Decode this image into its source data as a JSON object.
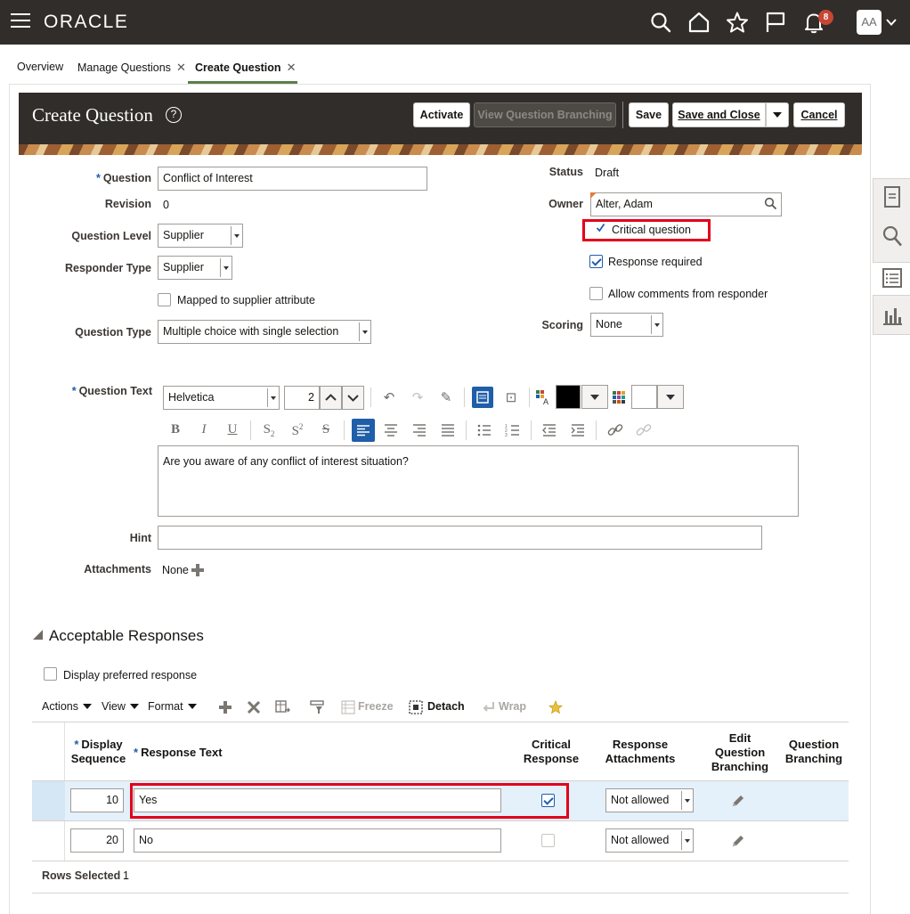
{
  "app": {
    "brand": "ORACLE",
    "notification_count": "8",
    "avatar_initials": "AA"
  },
  "tabs": [
    {
      "label": "Overview"
    },
    {
      "label": "Manage Questions"
    },
    {
      "label": "Create Question"
    }
  ],
  "header": {
    "title": "Create Question",
    "activate": "Activate",
    "view_branching": "View Question Branching",
    "save": "Save",
    "save_close": "Save and Close",
    "cancel": "Cancel"
  },
  "form": {
    "question_label": "Question",
    "question_value": "Conflict of Interest",
    "revision_label": "Revision",
    "revision_value": "0",
    "question_level_label": "Question Level",
    "question_level_value": "Supplier",
    "responder_type_label": "Responder Type",
    "responder_type_value": "Supplier",
    "mapped_label": "Mapped to supplier attribute",
    "question_type_label": "Question Type",
    "question_type_value": "Multiple choice with single selection",
    "status_label": "Status",
    "status_value": "Draft",
    "owner_label": "Owner",
    "owner_value": "Alter, Adam",
    "critical_label": "Critical question",
    "response_required_label": "Response required",
    "allow_comments_label": "Allow comments from responder",
    "scoring_label": "Scoring",
    "scoring_value": "None",
    "question_text_label": "Question Text",
    "font_value": "Helvetica",
    "font_size_value": "2",
    "question_text_value": "Are you aware of any conflict of interest situation?",
    "hint_label": "Hint",
    "hint_value": "",
    "attachments_label": "Attachments",
    "attachments_value": "None"
  },
  "responses": {
    "section_title": "Acceptable Responses",
    "display_preferred_label": "Display preferred response",
    "toolbar": {
      "actions": "Actions",
      "view": "View",
      "format": "Format",
      "freeze": "Freeze",
      "detach": "Detach",
      "wrap": "Wrap"
    },
    "columns": {
      "display_sequence_1": "Display",
      "display_sequence_2": "Sequence",
      "response_text": "Response Text",
      "critical_1": "Critical",
      "critical_2": "Response",
      "attachments_1": "Response",
      "attachments_2": "Attachments",
      "edit_branch_1": "Edit",
      "edit_branch_2": "Question",
      "edit_branch_3": "Branching",
      "branch_1": "Question",
      "branch_2": "Branching"
    },
    "rows": [
      {
        "sequence": "10",
        "text": "Yes",
        "critical": true,
        "attachments": "Not allowed"
      },
      {
        "sequence": "20",
        "text": "No",
        "critical": false,
        "attachments": "Not allowed"
      }
    ],
    "rows_selected_label": "Rows Selected",
    "rows_selected_value": "1"
  },
  "colors": {
    "topbar": "#312d2a",
    "accent_blue": "#1f5ea8",
    "highlight_red": "#e3001b",
    "selected_row": "#e4f0fa"
  }
}
